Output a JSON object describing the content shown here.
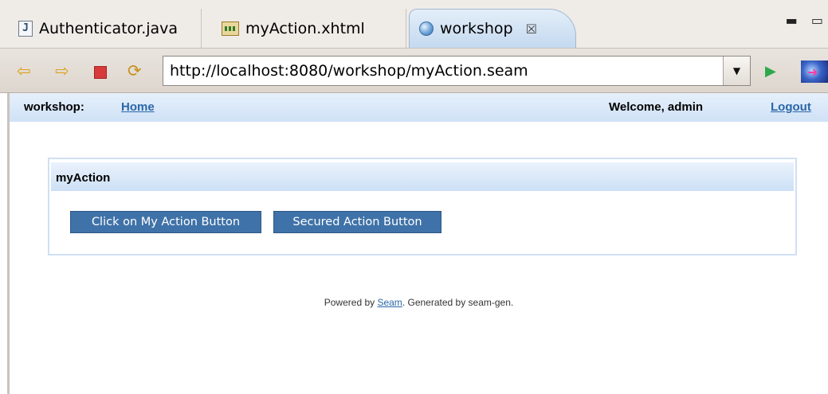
{
  "tabs": [
    {
      "label": "Authenticator.java",
      "icon": "java-file-icon"
    },
    {
      "label": "myAction.xhtml",
      "icon": "xhtml-file-icon"
    },
    {
      "label": "workshop",
      "icon": "globe-icon",
      "active": true,
      "close": "☒"
    }
  ],
  "window_controls": "▬ ▭",
  "toolbar": {
    "url": "http://localhost:8080/workshop/myAction.seam",
    "dropdown_glyph": "▼",
    "go_glyph": "▶"
  },
  "header": {
    "site": "workshop:",
    "home_link": "Home",
    "welcome": "Welcome, admin",
    "logout_link": "Logout"
  },
  "panel": {
    "title": "myAction",
    "buttons": [
      "Click on My Action Button",
      "Secured Action Button"
    ]
  },
  "footer": {
    "prefix": "Powered by ",
    "link": "Seam",
    "suffix": ". Generated by seam-gen."
  },
  "colors": {
    "header_gradient_top": "#e6f0fb",
    "header_gradient_bottom": "#cfe1f6",
    "link": "#2b67a8",
    "button_bg": "#3f72a8"
  }
}
